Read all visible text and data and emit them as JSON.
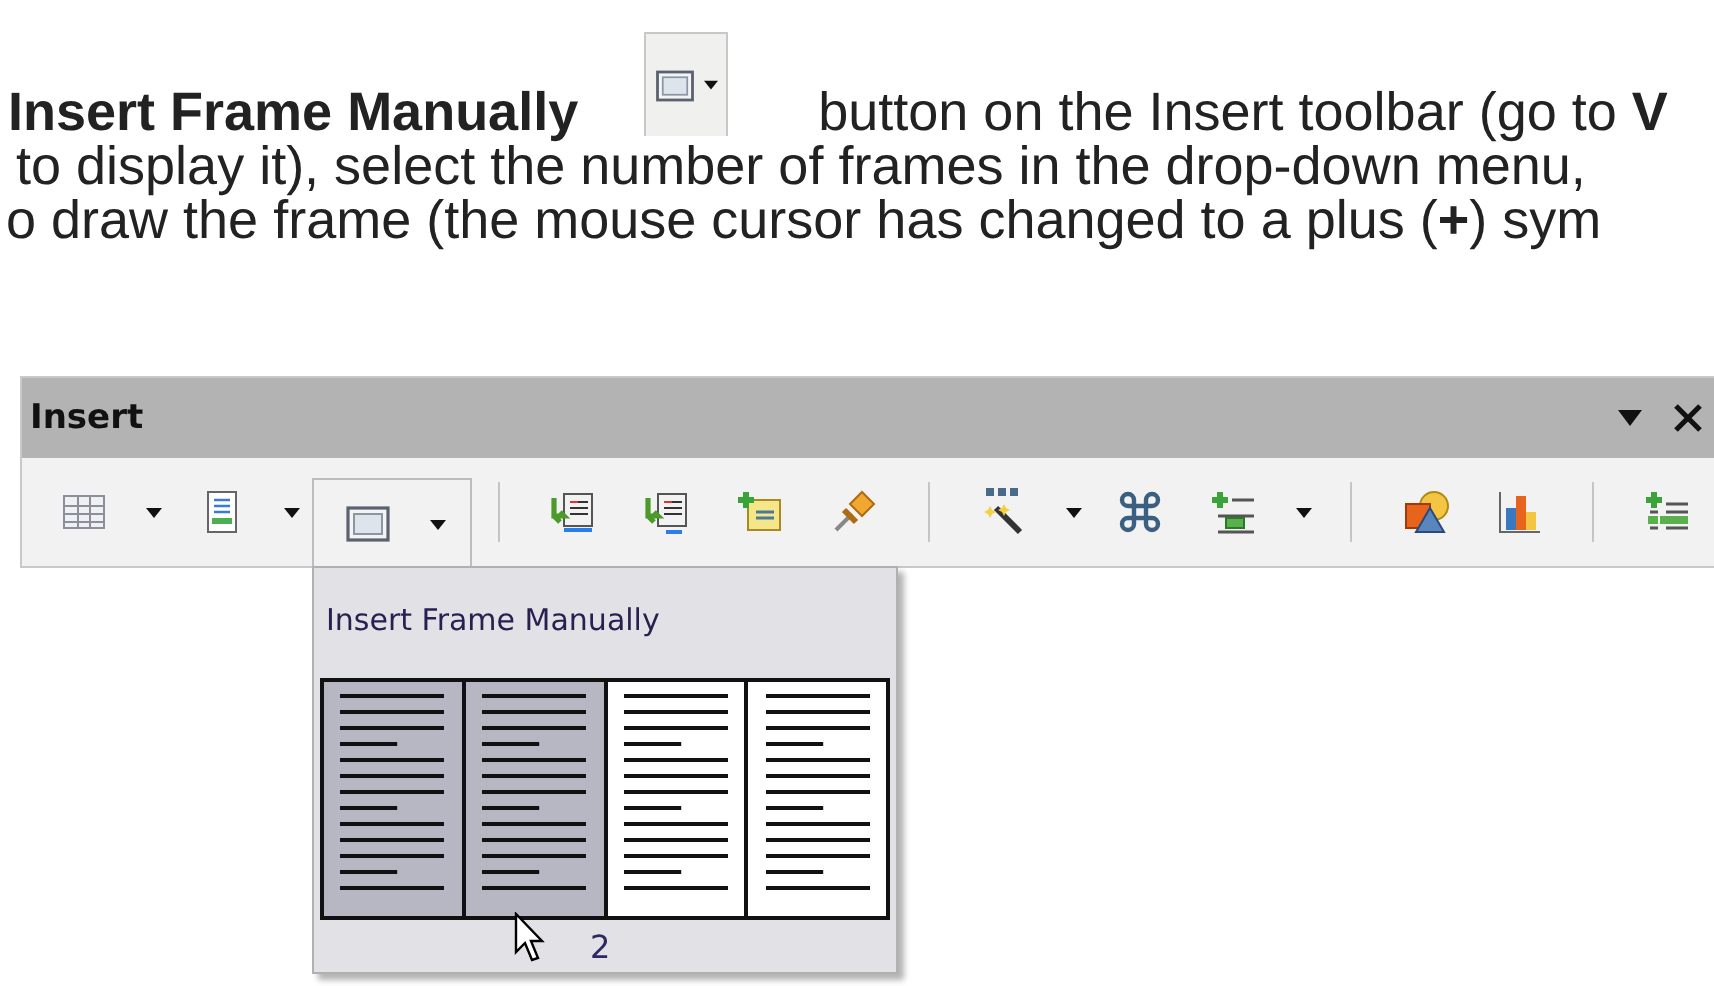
{
  "paragraph": {
    "line_1": {
      "before": "Insert Frame Manually",
      "after": "button on the Insert toolbar (go to **V**"
    },
    "line_2": "to display it), select the number of frames in the drop-down menu,",
    "line_3": "o draw the frame (the mouse cursor has changed to a plus (**+**) sym"
  },
  "toolbar": {
    "title": "Insert",
    "items": [
      {
        "kind": "button",
        "dropdown": true,
        "open": false
      },
      {
        "kind": "button",
        "dropdown": true,
        "open": false
      },
      {
        "kind": "button",
        "dropdown": true,
        "open": true
      },
      {
        "kind": "separator"
      },
      {
        "kind": "button",
        "dropdown": false,
        "open": false
      },
      {
        "kind": "button",
        "dropdown": false,
        "open": false
      },
      {
        "kind": "button",
        "dropdown": false,
        "open": false
      },
      {
        "kind": "button",
        "dropdown": false,
        "open": false
      },
      {
        "kind": "separator"
      },
      {
        "kind": "button",
        "dropdown": true,
        "open": false
      },
      {
        "kind": "button",
        "dropdown": false,
        "open": false
      },
      {
        "kind": "button",
        "dropdown": true,
        "open": false
      },
      {
        "kind": "separator"
      },
      {
        "kind": "button",
        "dropdown": false,
        "open": false
      },
      {
        "kind": "button",
        "dropdown": false,
        "open": false
      },
      {
        "kind": "separator"
      },
      {
        "kind": "button",
        "dropdown": false,
        "open": false
      }
    ]
  },
  "frame_menu": {
    "title": "Insert Frame Manually",
    "columns": [
      {
        "selected": true
      },
      {
        "selected": true
      },
      {
        "selected": false
      },
      {
        "selected": false
      }
    ],
    "count_label": "2"
  }
}
